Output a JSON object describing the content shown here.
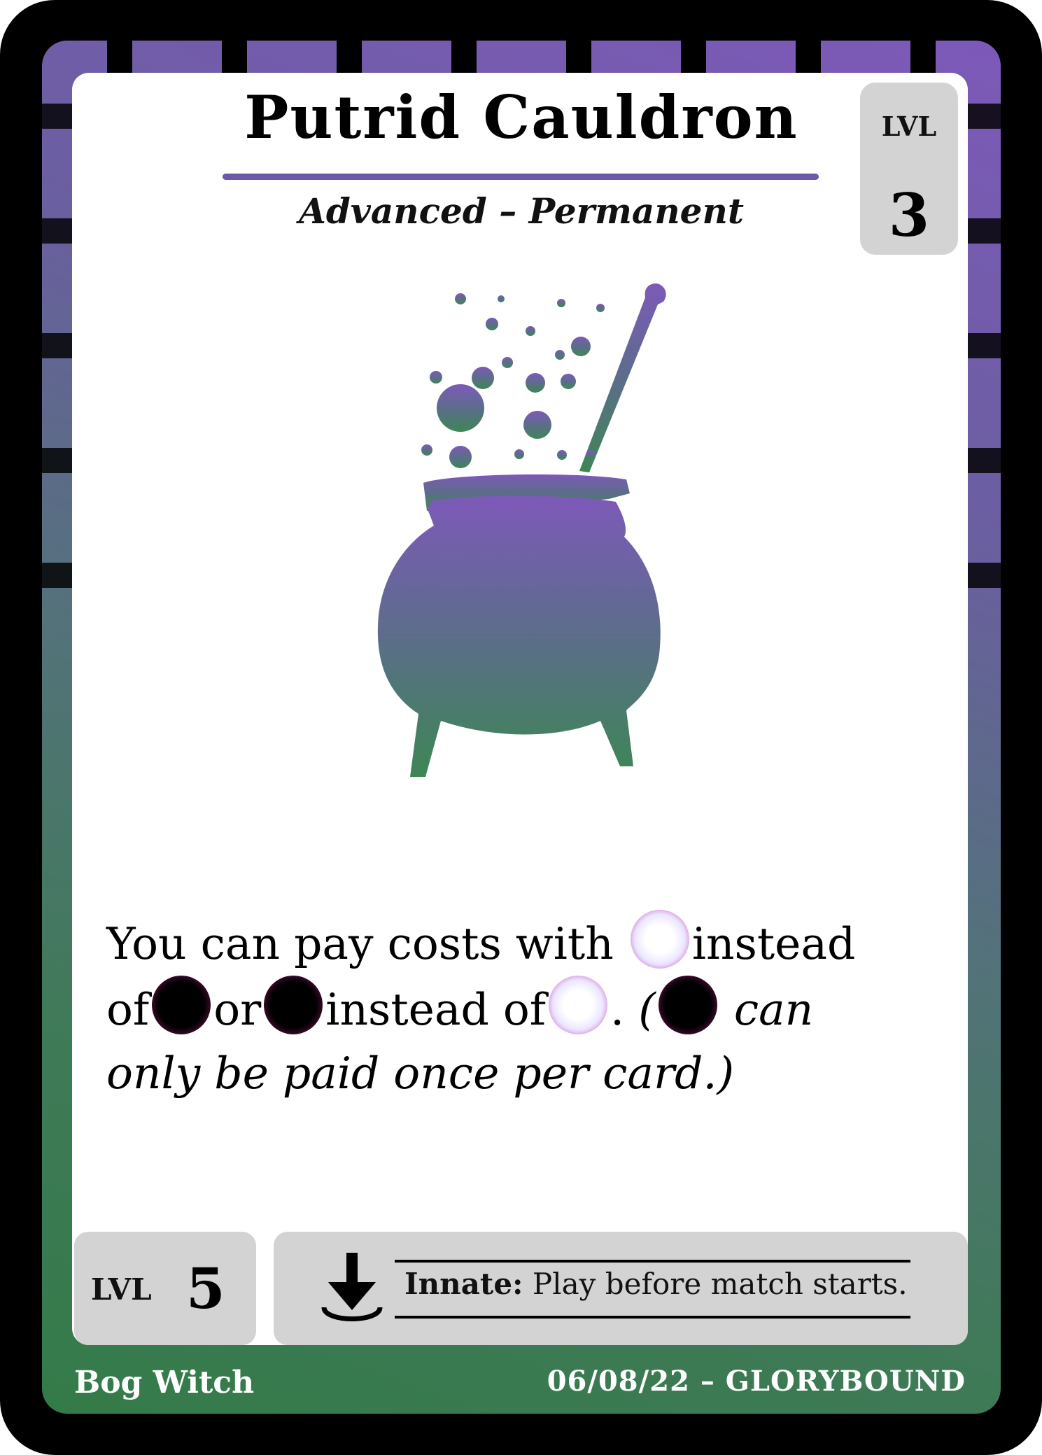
{
  "card": {
    "title": "Putrid Cauldron",
    "subtitle": "Advanced – Permanent",
    "level_badge": {
      "label": "LVL",
      "value": "3"
    },
    "art_icon": "cauldron-with-ladle-and-bubbles",
    "rules": {
      "line1_before_orb": "You can pay costs with",
      "line1_after_orb": "instead",
      "line2_of": "of",
      "line2_or": "or",
      "line2_instead_of": "instead of",
      "line2_period": ".",
      "line2_paren": "(",
      "line2_can": "can",
      "line3": "only be paid once per card.)"
    },
    "orb_icons": {
      "light": "light-orb-icon",
      "dark": "dark-orb-icon"
    },
    "level_box": {
      "label": "LVL",
      "value": "5"
    },
    "innate": {
      "icon": "download-arrow-icon",
      "label": "Innate:",
      "text": "Play before match starts."
    },
    "footer": {
      "class_name": "Bog Witch",
      "credit": "06/08/22 – GLORYBOUND"
    },
    "colors": {
      "purple": "#7d59b9",
      "green": "#347b49",
      "accent_rule": "#6c5aa8",
      "box_grey": "#d3d3d3"
    }
  }
}
